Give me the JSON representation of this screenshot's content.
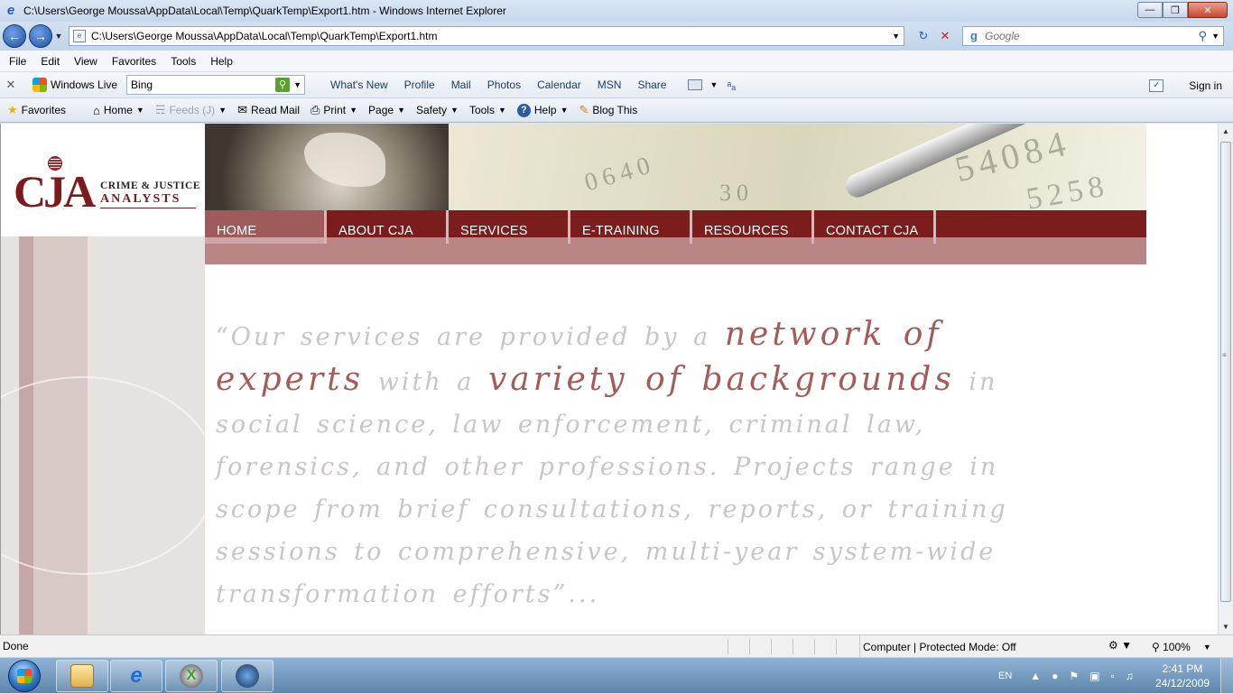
{
  "window": {
    "title": "C:\\Users\\George Moussa\\AppData\\Local\\Temp\\QuarkTemp\\Export1.htm - Windows Internet Explorer"
  },
  "addressbar": {
    "url": "C:\\Users\\George Moussa\\AppData\\Local\\Temp\\QuarkTemp\\Export1.htm",
    "search_placeholder": "Google"
  },
  "menubar": {
    "items": [
      "File",
      "Edit",
      "View",
      "Favorites",
      "Tools",
      "Help"
    ]
  },
  "wltoolbar": {
    "brand": "Windows Live",
    "search_value": "Bing",
    "links": [
      "What's New",
      "Profile",
      "Mail",
      "Photos",
      "Calendar",
      "MSN",
      "Share"
    ],
    "signin": "Sign in"
  },
  "cmdbar": {
    "favorites": "Favorites",
    "home": "Home",
    "feeds": "Feeds (J)",
    "read_mail": "Read Mail",
    "print": "Print",
    "page": "Page",
    "safety": "Safety",
    "tools": "Tools",
    "help": "Help",
    "blog_this": "Blog This"
  },
  "site": {
    "logo_text": "CJA",
    "logo_tag1": "CRIME & JUSTICE",
    "logo_tag2": "ANALYSTS",
    "nav": [
      "HOME",
      "ABOUT CJA",
      "SERVICES",
      "E-TRAINING",
      "RESOURCES",
      "CONTACT CJA"
    ],
    "active_nav_index": 0,
    "banner_digits": [
      "54084",
      "5258",
      "0640",
      "30"
    ],
    "quote": {
      "p1": "“Our services are provided by a",
      "h1": "network of experts",
      "p2": "with a",
      "h2": "variety of backgrounds",
      "p3": "in social science, law enforcement, criminal law, forensics, and other professions. Projects range in scope from brief consultations, reports, or training sessions to comprehensive, multi-year system-wide transformation efforts”..."
    },
    "colors": {
      "brand": "#7c1a1d",
      "nav_lower": "#b98585",
      "quote_highlight": "#a55b58",
      "quote_text": "#c9c5c4"
    }
  },
  "statusbar": {
    "text": "Done",
    "zone": "Computer | Protected Mode: Off",
    "zoom": "100%"
  },
  "taskbar": {
    "lang": "EN",
    "time": "2:41 PM",
    "date": "24/12/2009",
    "pinned_icons": [
      "explorer-icon",
      "internet-explorer-icon",
      "xbox-icon",
      "camera-icon"
    ]
  }
}
